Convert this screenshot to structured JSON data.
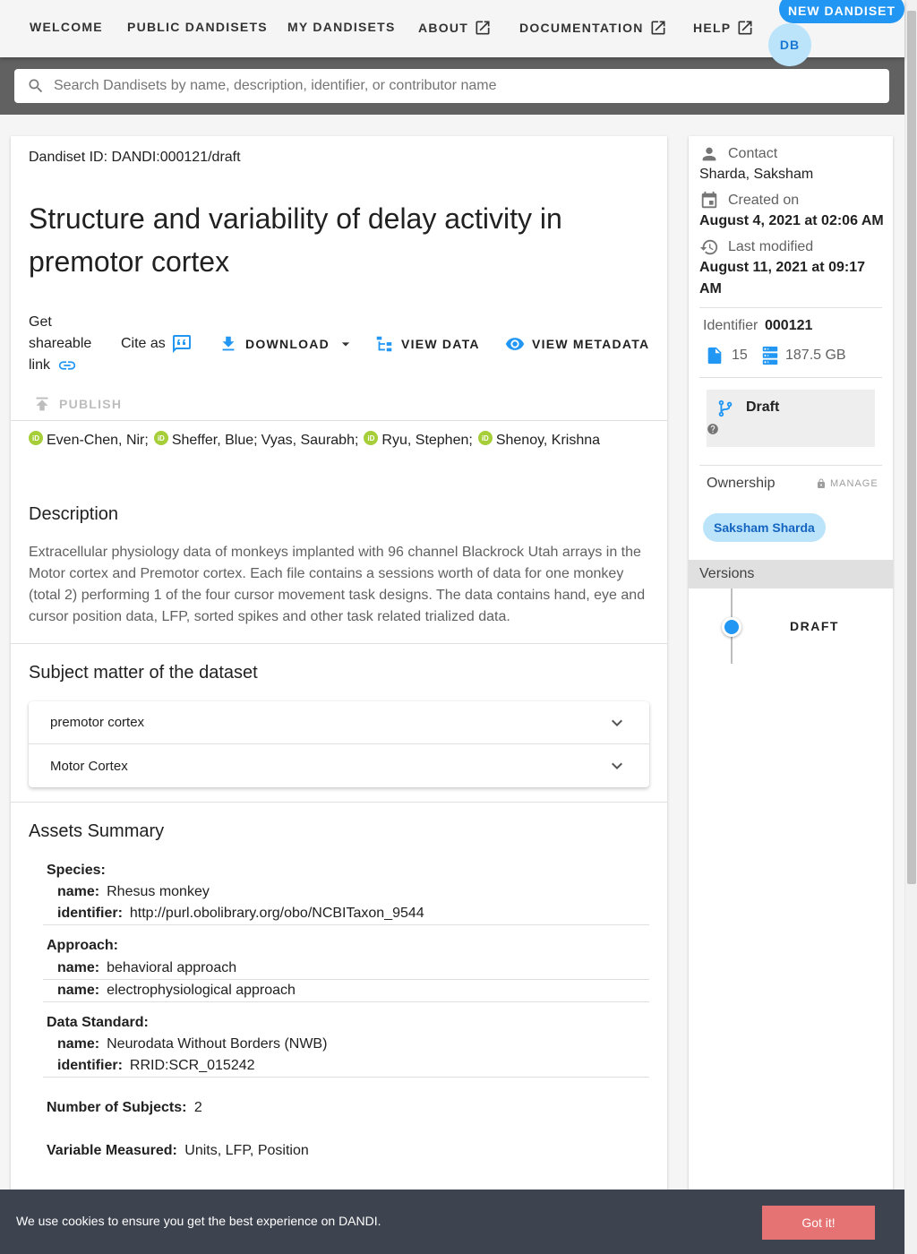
{
  "nav": {
    "items": [
      {
        "label": "WELCOME"
      },
      {
        "label": "PUBLIC DANDISETS"
      },
      {
        "label": "MY DANDISETS"
      },
      {
        "label": "ABOUT"
      },
      {
        "label": "DOCUMENTATION"
      },
      {
        "label": "HELP"
      }
    ],
    "new_dandiset": "NEW DANDISET",
    "avatar_initials": "DB"
  },
  "search": {
    "placeholder": "Search Dandisets by name, description, identifier, or contributor name"
  },
  "dandiset": {
    "id_line": "Dandiset ID: DANDI:000121/draft",
    "title": "Structure and variability of delay activity in premotor cortex",
    "actions": {
      "share": "Get shareable link",
      "cite": "Cite as",
      "download": "DOWNLOAD",
      "view_data": "VIEW DATA",
      "view_metadata": "VIEW METADATA",
      "publish": "PUBLISH"
    },
    "contributors": [
      {
        "name": "Even-Chen, Nir;",
        "orcid": true
      },
      {
        "name": "Sheffer, Blue;",
        "orcid": true
      },
      {
        "name": "Vyas, Saurabh;",
        "orcid": false
      },
      {
        "name": "Ryu, Stephen;",
        "orcid": true
      },
      {
        "name": "Shenoy, Krishna",
        "orcid": true
      }
    ],
    "description_title": "Description",
    "description": "Extracellular physiology data of monkeys implanted with 96 channel Blackrock Utah arrays in the Motor cortex and Premotor cortex. Each file contains a sessions worth of data for one monkey (total 2) performing 1 of the four cursor movement task designs. The data contains hand, eye and cursor position data, LFP, sorted spikes and other task related trialized data.",
    "subject_title": "Subject matter of the dataset",
    "subjects": [
      "premotor cortex",
      "Motor Cortex"
    ],
    "assets_title": "Assets Summary",
    "assets": {
      "species_heading": "Species:",
      "species_name_key": "name:",
      "species_name": "Rhesus monkey",
      "species_id_key": "identifier:",
      "species_id": "http://purl.obolibrary.org/obo/NCBITaxon_9544",
      "approach_heading": "Approach:",
      "approach_key": "name:",
      "approach_1": "behavioral approach",
      "approach_2": "electrophysiological approach",
      "standard_heading": "Data Standard:",
      "standard_name_key": "name:",
      "standard_name": "Neurodata Without Borders (NWB)",
      "standard_id_key": "identifier:",
      "standard_id": "RRID:SCR_015242",
      "subjects_key": "Number of Subjects:",
      "subjects_value": "2",
      "variable_key": "Variable Measured:",
      "variable_value": "Units, LFP, Position"
    }
  },
  "sidebar": {
    "contact_label": "Contact",
    "contact_value": "Sharda, Saksham",
    "created_label": "Created on",
    "created_value": "August 4, 2021 at 02:06 AM",
    "modified_label": "Last modified",
    "modified_value": "August 11, 2021 at 09:17 AM",
    "identifier_label": "Identifier",
    "identifier_value": "000121",
    "file_count": "15",
    "size": "187.5 GB",
    "draft_label": "Draft",
    "ownership_label": "Ownership",
    "manage_label": "MANAGE",
    "owner_chip": "Saksham Sharda",
    "versions_label": "Versions",
    "version_item": "DRAFT"
  },
  "cookie": {
    "text": "We use cookies to ensure you get the best experience on DANDI.",
    "button": "Got it!"
  },
  "colors": {
    "accent": "#2196f3",
    "orcid": "#a6ce39",
    "cookie_button": "#e57373"
  }
}
